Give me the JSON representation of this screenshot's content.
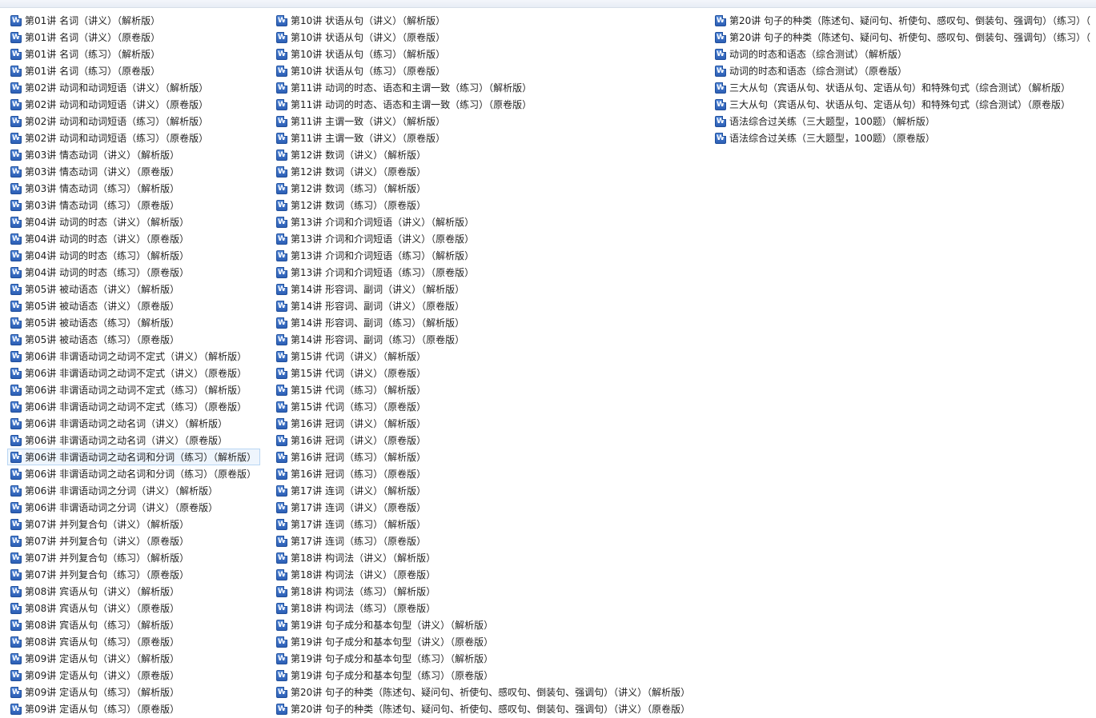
{
  "icon": "word-document-icon",
  "accent_color": "#2d5fb5",
  "selected_index": 26,
  "columns": [
    [
      "第01讲 名词（讲义）（解析版）",
      "第01讲 名词（讲义）（原卷版）",
      "第01讲 名词（练习）（解析版）",
      "第01讲 名词（练习）（原卷版）",
      "第02讲 动词和动词短语（讲义）（解析版）",
      "第02讲 动词和动词短语（讲义）（原卷版）",
      "第02讲 动词和动词短语（练习）（解析版）",
      "第02讲 动词和动词短语（练习）（原卷版）",
      "第03讲 情态动词（讲义）（解析版）",
      "第03讲 情态动词（讲义）（原卷版）",
      "第03讲 情态动词（练习）（解析版）",
      "第03讲 情态动词（练习）（原卷版）",
      "第04讲 动词的时态（讲义）（解析版）",
      "第04讲 动词的时态（讲义）（原卷版）",
      "第04讲 动词的时态（练习）（解析版）",
      "第04讲 动词的时态（练习）（原卷版）",
      "第05讲 被动语态（讲义）（解析版）",
      "第05讲 被动语态（讲义）（原卷版）",
      "第05讲 被动语态（练习）（解析版）",
      "第05讲 被动语态（练习）（原卷版）",
      "第06讲 非谓语动词之动词不定式（讲义）（解析版）",
      "第06讲 非谓语动词之动词不定式（讲义）（原卷版）",
      "第06讲 非谓语动词之动词不定式（练习）（解析版）",
      "第06讲 非谓语动词之动词不定式（练习）（原卷版）",
      "第06讲 非谓语动词之动名词（讲义）（解析版）",
      "第06讲 非谓语动词之动名词（讲义）（原卷版）",
      "第06讲 非谓语动词之动名词和分词（练习）（解析版）",
      "第06讲 非谓语动词之动名词和分词（练习）（原卷版）",
      "第06讲 非谓语动词之分词（讲义）（解析版）",
      "第06讲 非谓语动词之分词（讲义）（原卷版）",
      "第07讲 并列复合句（讲义）（解析版）",
      "第07讲 并列复合句（讲义）（原卷版）",
      "第07讲 并列复合句（练习）（解析版）",
      "第07讲 并列复合句（练习）（原卷版）",
      "第08讲 宾语从句（讲义）（解析版）",
      "第08讲 宾语从句（讲义）（原卷版）",
      "第08讲 宾语从句（练习）（解析版）",
      "第08讲 宾语从句（练习）（原卷版）",
      "第09讲 定语从句（讲义）（解析版）",
      "第09讲 定语从句（讲义）（原卷版）",
      "第09讲 定语从句（练习）（解析版）",
      "第09讲 定语从句（练习）（原卷版）"
    ],
    [
      "第10讲 状语从句（讲义）（解析版）",
      "第10讲 状语从句（讲义）（原卷版）",
      "第10讲 状语从句（练习）（解析版）",
      "第10讲 状语从句（练习）（原卷版）",
      "第11讲 动词的时态、语态和主谓一致（练习）（解析版）",
      "第11讲 动词的时态、语态和主谓一致（练习）（原卷版）",
      "第11讲 主谓一致（讲义）（解析版）",
      "第11讲 主谓一致（讲义）（原卷版）",
      "第12讲 数词（讲义）（解析版）",
      "第12讲 数词（讲义）（原卷版）",
      "第12讲 数词（练习）（解析版）",
      "第12讲 数词（练习）（原卷版）",
      "第13讲 介词和介词短语（讲义）（解析版）",
      "第13讲 介词和介词短语（讲义）（原卷版）",
      "第13讲 介词和介词短语（练习）（解析版）",
      "第13讲 介词和介词短语（练习）（原卷版）",
      "第14讲 形容词、副词（讲义）（解析版）",
      "第14讲 形容词、副词（讲义）（原卷版）",
      "第14讲 形容词、副词（练习）（解析版）",
      "第14讲 形容词、副词（练习）（原卷版）",
      "第15讲 代词（讲义）（解析版）",
      "第15讲 代词（讲义）（原卷版）",
      "第15讲 代词（练习）（解析版）",
      "第15讲 代词（练习）（原卷版）",
      "第16讲 冠词（讲义）（解析版）",
      "第16讲 冠词（讲义）（原卷版）",
      "第16讲 冠词（练习）（解析版）",
      "第16讲 冠词（练习）（原卷版）",
      "第17讲 连词（讲义）（解析版）",
      "第17讲 连词（讲义）（原卷版）",
      "第17讲 连词（练习）（解析版）",
      "第17讲 连词（练习）（原卷版）",
      "第18讲 构词法（讲义）（解析版）",
      "第18讲 构词法（讲义）（原卷版）",
      "第18讲 构词法（练习）（解析版）",
      "第18讲 构词法（练习）（原卷版）",
      "第19讲 句子成分和基本句型（讲义）（解析版）",
      "第19讲 句子成分和基本句型（讲义）（原卷版）",
      "第19讲 句子成分和基本句型（练习）（解析版）",
      "第19讲 句子成分和基本句型（练习）（原卷版）",
      "第20讲 句子的种类（陈述句、疑问句、祈使句、感叹句、倒装句、强调句）（讲义）（解析版）",
      "第20讲 句子的种类（陈述句、疑问句、祈使句、感叹句、倒装句、强调句）（讲义）（原卷版）"
    ],
    [
      "第20讲 句子的种类（陈述句、疑问句、祈使句、感叹句、倒装句、强调句）（练习）（",
      "第20讲 句子的种类（陈述句、疑问句、祈使句、感叹句、倒装句、强调句）（练习）（",
      "动词的时态和语态（综合测试）（解析版）",
      "动词的时态和语态（综合测试）（原卷版）",
      "三大从句（宾语从句、状语从句、定语从句）和特殊句式（综合测试）（解析版）",
      "三大从句（宾语从句、状语从句、定语从句）和特殊句式（综合测试）（原卷版）",
      "语法综合过关练（三大题型，100题）（解析版）",
      "语法综合过关练（三大题型，100题）（原卷版）"
    ]
  ]
}
